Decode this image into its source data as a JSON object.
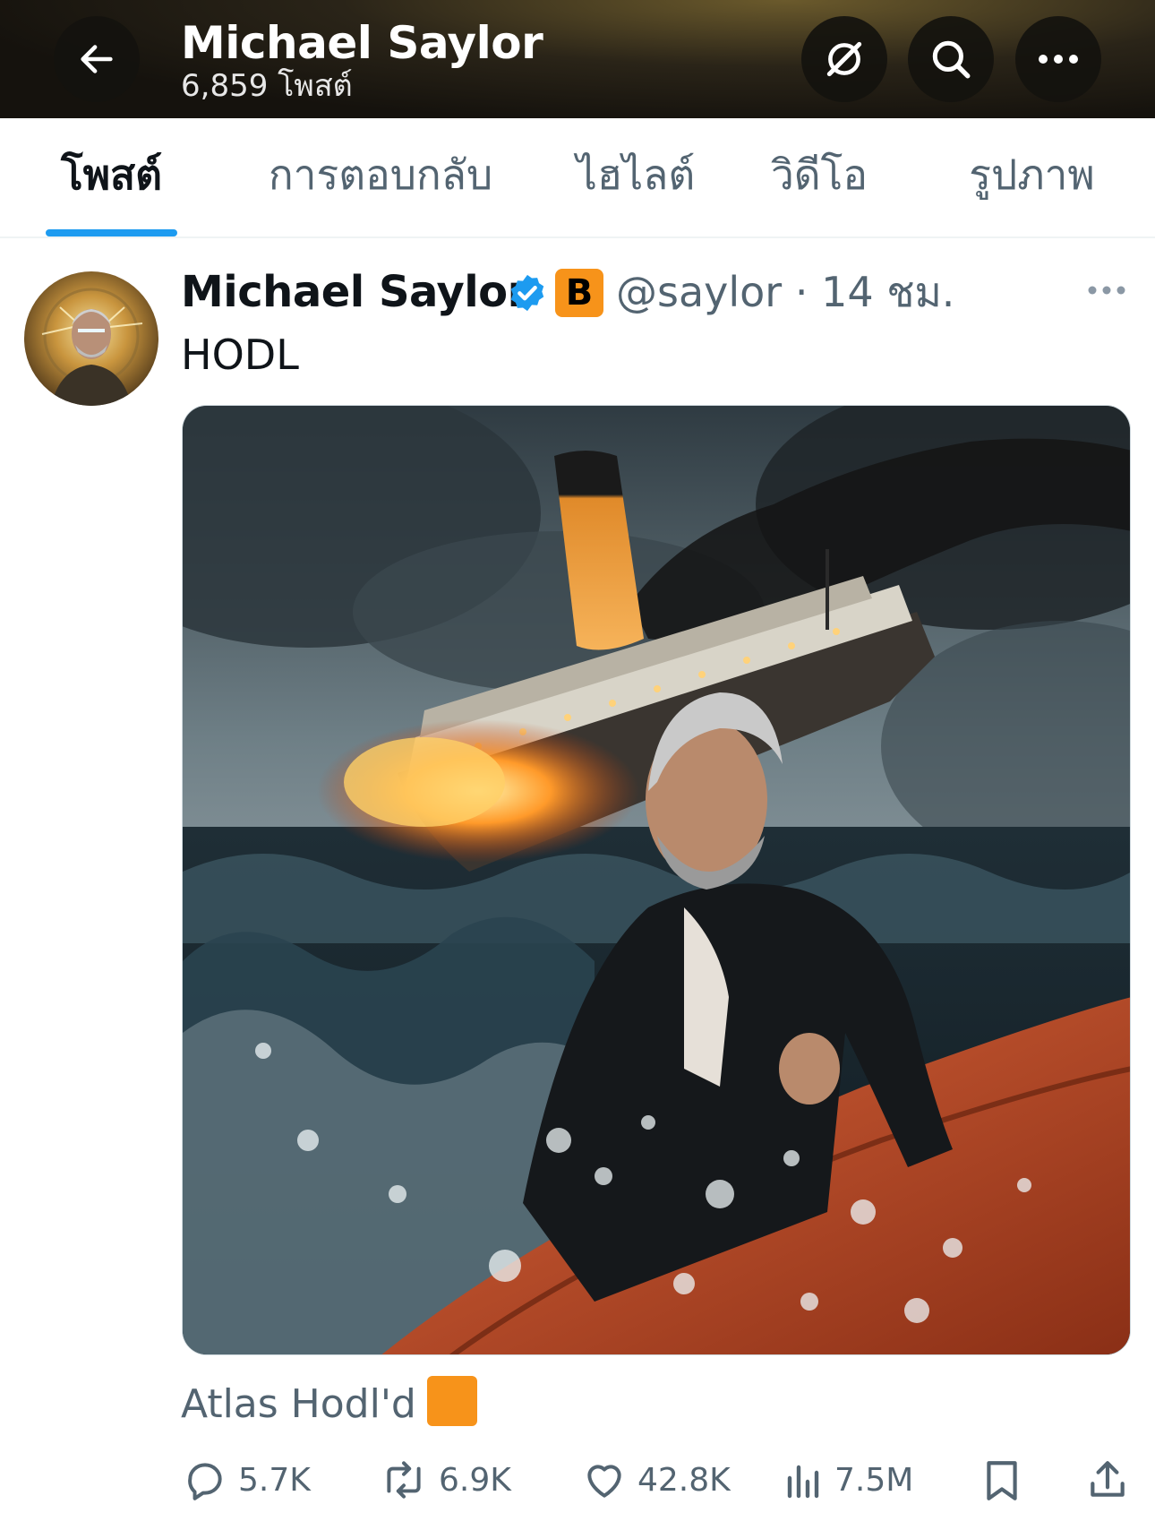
{
  "header": {
    "title": "Michael Saylor",
    "post_count": "6,859 โพสต์",
    "icons": [
      "back-arrow-icon",
      "grok-icon",
      "search-icon",
      "more-icon"
    ]
  },
  "tabs": [
    {
      "label": "โพสต์",
      "active": true
    },
    {
      "label": "การตอบกลับ",
      "active": false
    },
    {
      "label": "ไฮไลต์",
      "active": false
    },
    {
      "label": "วิดีโอ",
      "active": false
    },
    {
      "label": "รูปภาพ",
      "active": false
    }
  ],
  "post": {
    "author_name": "Michael Saylor",
    "badge_letter": "B",
    "handle_time": "@saylor · 14 ชม.",
    "text": "HODL",
    "quote": "Atlas Hodl'd",
    "actions": {
      "replies": "5.7K",
      "reposts": "6.9K",
      "likes": "42.8K",
      "views": "7.5M"
    }
  },
  "colors": {
    "accent": "#1d9bf0",
    "bitcoin_orange": "#f7931a",
    "secondary_text": "#536471"
  }
}
